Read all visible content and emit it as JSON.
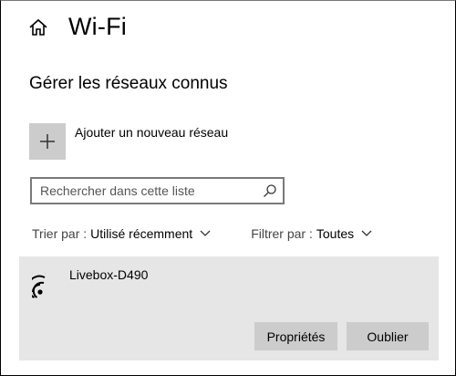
{
  "header": {
    "title": "Wi-Fi",
    "home_icon": "home-icon"
  },
  "section_title": "Gérer les réseaux connus",
  "add_network": {
    "label": "Ajouter un nouveau réseau",
    "icon": "plus-icon"
  },
  "search": {
    "placeholder": "Rechercher dans cette liste",
    "value": "",
    "icon": "search-icon"
  },
  "sort": {
    "label": "Trier par :",
    "value": "Utilisé récemment"
  },
  "filter": {
    "label": "Filtrer par :",
    "value": "Toutes"
  },
  "networks": [
    {
      "name": "Livebox-D490",
      "icon": "wifi-icon",
      "buttons": {
        "properties": "Propriétés",
        "forget": "Oublier"
      }
    }
  ],
  "colors": {
    "network_bg": "#e6e6e6",
    "button_bg": "#cccccc",
    "add_box_bg": "#cccccc"
  }
}
